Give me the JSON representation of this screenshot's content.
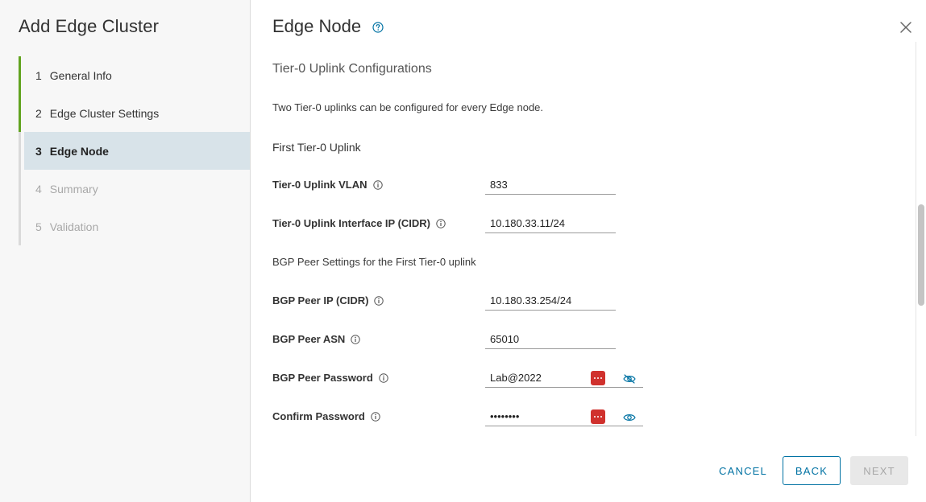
{
  "wizard": {
    "title": "Add Edge Cluster"
  },
  "steps": [
    {
      "num": "1",
      "label": "General Info",
      "state": "done"
    },
    {
      "num": "2",
      "label": "Edge Cluster Settings",
      "state": "done"
    },
    {
      "num": "3",
      "label": "Edge Node",
      "state": "current"
    },
    {
      "num": "4",
      "label": "Summary",
      "state": "disabled"
    },
    {
      "num": "5",
      "label": "Validation",
      "state": "disabled"
    }
  ],
  "page": {
    "title": "Edge Node",
    "section_title": "Tier-0 Uplink Configurations",
    "description": "Two Tier-0 uplinks can be configured for every Edge node.",
    "first_uplink_heading": "First Tier-0 Uplink",
    "bgp_heading": "BGP Peer Settings for the First Tier-0 uplink"
  },
  "fields": {
    "uplink_vlan": {
      "label": "Tier-0 Uplink VLAN",
      "value": "833"
    },
    "uplink_ip": {
      "label": "Tier-0 Uplink Interface IP (CIDR)",
      "value": "10.180.33.11/24"
    },
    "bgp_peer_ip": {
      "label": "BGP Peer IP (CIDR)",
      "value": "10.180.33.254/24"
    },
    "bgp_peer_asn": {
      "label": "BGP Peer ASN",
      "value": "65010"
    },
    "bgp_peer_password": {
      "label": "BGP Peer Password",
      "value": "Lab@2022"
    },
    "confirm_password": {
      "label": "Confirm Password",
      "value": "••••••••"
    }
  },
  "buttons": {
    "cancel": "CANCEL",
    "back": "BACK",
    "next": "NEXT"
  },
  "colors": {
    "accent": "#0072a3",
    "done_step": "#62a420",
    "current_step_bg": "#d8e3e9",
    "password_manager": "#d0312d"
  },
  "icons": [
    "help-circle-icon",
    "close-icon",
    "info-icon",
    "password-manager-icon",
    "eye-hide-icon",
    "eye-icon"
  ]
}
